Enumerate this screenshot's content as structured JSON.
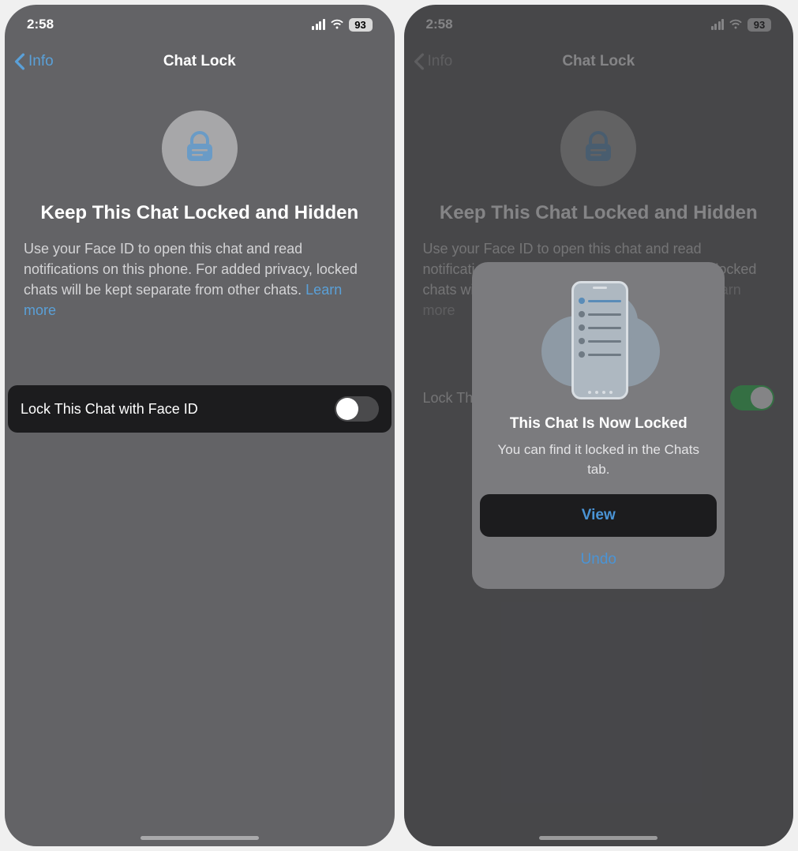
{
  "left": {
    "status": {
      "time": "2:58",
      "battery": "93"
    },
    "nav": {
      "back_label": "Info",
      "title": "Chat Lock"
    },
    "heading": "Keep This Chat Locked and Hidden",
    "description_text": "Use your Face ID to open this chat and read notifications on this phone. For added privacy, locked chats will be kept separate from other chats. ",
    "learn_more": "Learn more",
    "toggle_label": "Lock This Chat with Face ID",
    "toggle_on": false
  },
  "right": {
    "status": {
      "time": "2:58",
      "battery": "93"
    },
    "nav": {
      "back_label": "Info",
      "title": "Chat Lock"
    },
    "heading": "Keep This Chat Locked and Hidden",
    "description_text": "Use your Face ID to open this chat and read notifications on this phone. For added privacy, locked chats will be kept separate from other chats. ",
    "learn_more": "Learn more",
    "toggle_label": "Lock This Chat with Face ID",
    "toggle_on": true,
    "dialog": {
      "title": "This Chat Is Now Locked",
      "message": "You can find it locked in the Chats tab.",
      "primary": "View",
      "secondary": "Undo"
    }
  }
}
